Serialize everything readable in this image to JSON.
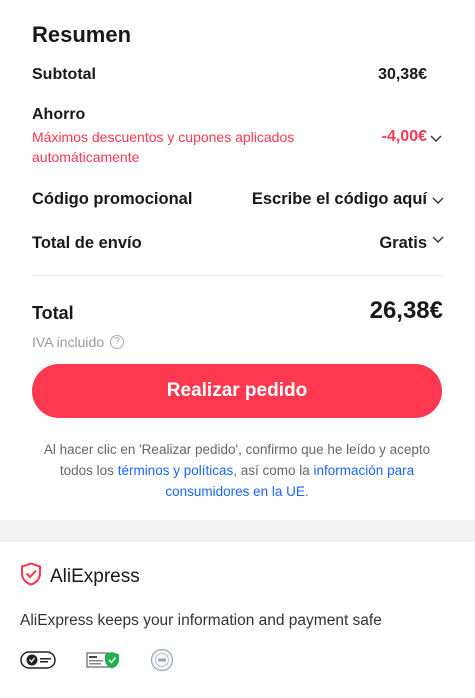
{
  "summary": {
    "title": "Resumen",
    "subtotal_label": "Subtotal",
    "subtotal_value": "30,38€",
    "saving_label": "Ahorro",
    "saving_note": "Máximos descuentos y cupones aplicados automáticamente",
    "saving_value": "-4,00€",
    "promo_label": "Código promocional",
    "promo_value": "Escribe el código aquí",
    "shipping_label": "Total de envío",
    "shipping_value": "Gratis",
    "total_label": "Total",
    "total_value": "26,38€",
    "vat_label": "IVA incluido",
    "order_button": "Realizar pedido",
    "legal_prefix": "Al hacer clic en 'Realizar pedido', confirmo que he leído y acepto todos los ",
    "legal_link_terms": "términos y políticas",
    "legal_middle": ", así como la ",
    "legal_link_info": "información para consumidores en la UE",
    "legal_suffix": "."
  },
  "trust": {
    "brand_name": "AliExpress",
    "message": "AliExpress keeps your information and payment safe",
    "badges": [
      "visa-secure-badge-icon",
      "ssl-secure-badge-icon",
      "pci-dss-badge-icon"
    ]
  },
  "colors": {
    "accent": "#fd384f",
    "link": "#1a66ff",
    "muted": "#999999"
  }
}
